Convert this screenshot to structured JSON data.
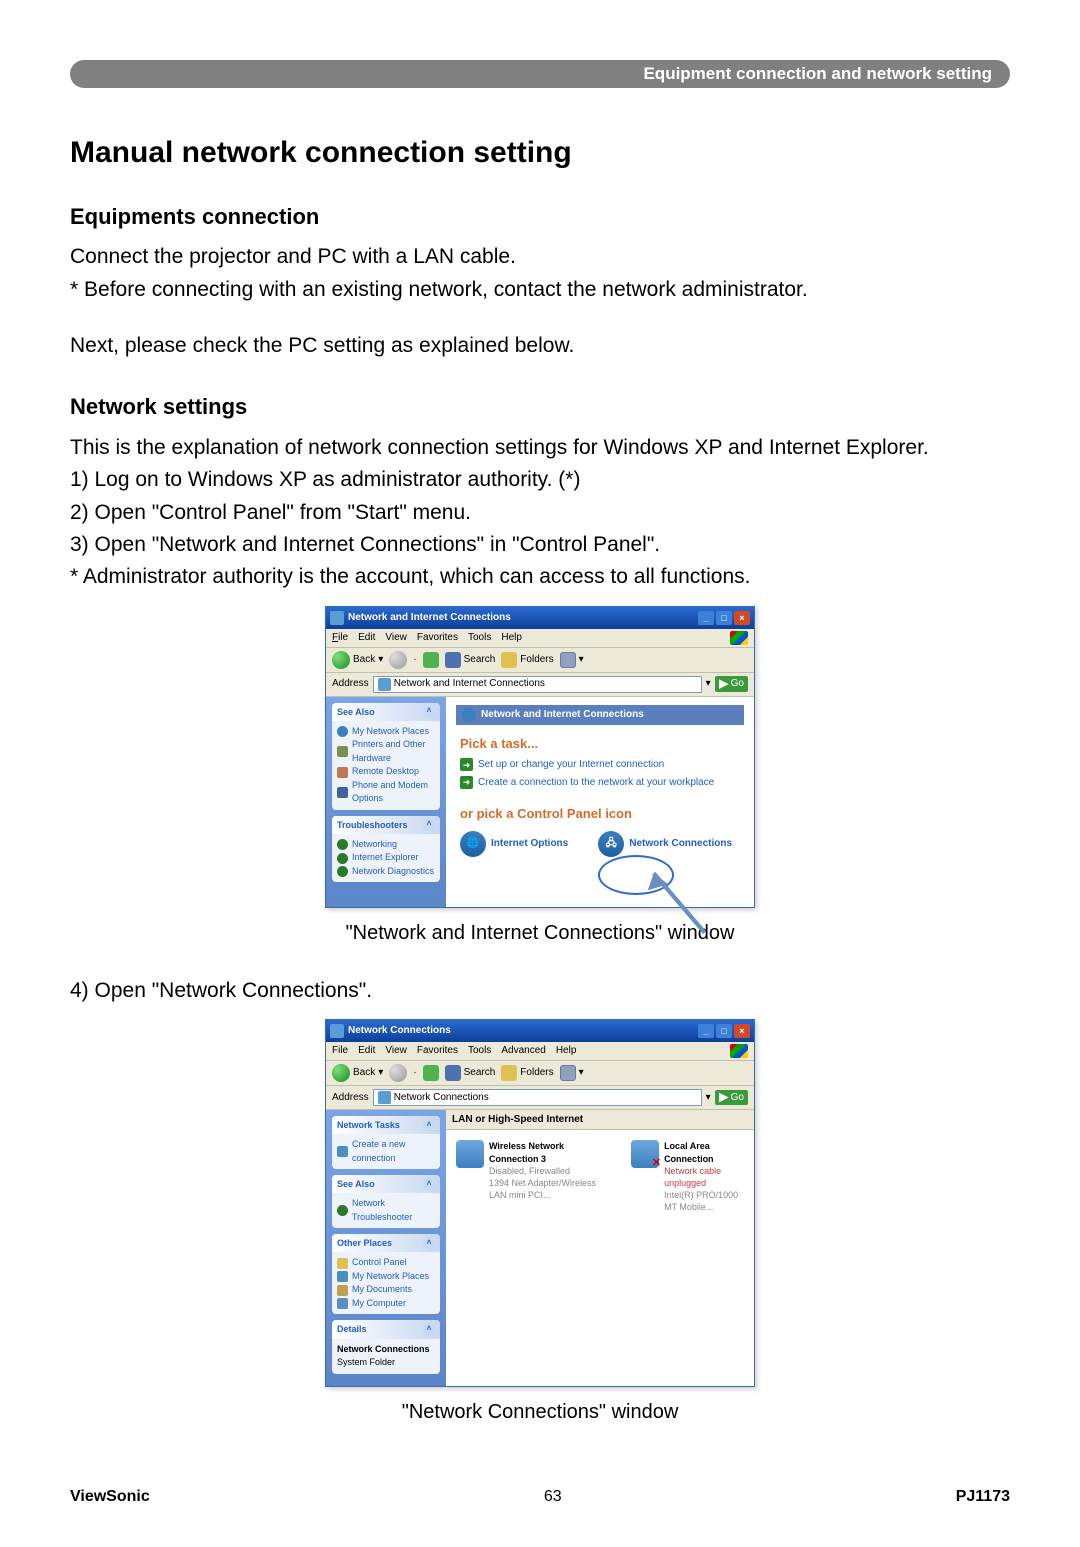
{
  "header": {
    "breadcrumb": "Equipment connection and network setting"
  },
  "title": "Manual network connection setting",
  "sec1": {
    "heading": "Equipments connection",
    "p1": "Connect the projector and PC with a LAN cable.",
    "p2": "* Before connecting with an existing network, contact the network administrator.",
    "p3": "Next, please check the PC setting as explained below."
  },
  "sec2": {
    "heading": "Network settings",
    "p1": "This is the explanation of network connection settings for Windows XP and Internet Explorer.",
    "l1": "1) Log on to Windows XP as administrator authority. (*)",
    "l2": "2) Open \"Control Panel\" from \"Start\" menu.",
    "l3": "3) Open \"Network and Internet Connections\" in \"Control Panel\".",
    "l4": "* Administrator authority is the account, which can access to all functions.",
    "caption1": "\"Network and Internet Connections\" window",
    "step4": "4) Open \"Network Connections\".",
    "caption2": "\"Network Connections\" window"
  },
  "win1": {
    "title": "Network and Internet Connections",
    "menus": {
      "file": "File",
      "edit": "Edit",
      "view": "View",
      "fav": "Favorites",
      "tools": "Tools",
      "help": "Help"
    },
    "toolbar": {
      "back": "Back",
      "search": "Search",
      "folders": "Folders"
    },
    "address_label": "Address",
    "address": "Network and Internet Connections",
    "go": "Go",
    "side": {
      "see_also": "See Also",
      "sa_items": [
        "My Network Places",
        "Printers and Other Hardware",
        "Remote Desktop",
        "Phone and Modem Options"
      ],
      "trouble": "Troubleshooters",
      "tr_items": [
        "Networking",
        "Internet Explorer",
        "Network Diagnostics"
      ]
    },
    "main": {
      "cat": "Network and Internet Connections",
      "pick": "Pick a task...",
      "t1": "Set up or change your Internet connection",
      "t2": "Create a connection to the network at your workplace",
      "or": "or pick a Control Panel icon",
      "io": "Internet Options",
      "nc": "Network Connections"
    }
  },
  "win2": {
    "title": "Network Connections",
    "menus": {
      "file": "File",
      "edit": "Edit",
      "view": "View",
      "fav": "Favorites",
      "tools": "Tools",
      "adv": "Advanced",
      "help": "Help"
    },
    "toolbar": {
      "back": "Back",
      "search": "Search",
      "folders": "Folders"
    },
    "address_label": "Address",
    "address": "Network Connections",
    "go": "Go",
    "side": {
      "ntasks": "Network Tasks",
      "ntask1": "Create a new connection",
      "see_also": "See Also",
      "sa1": "Network Troubleshooter",
      "other": "Other Places",
      "op_items": [
        "Control Panel",
        "My Network Places",
        "My Documents",
        "My Computer"
      ],
      "details": "Details",
      "det1": "Network Connections",
      "det2": "System Folder"
    },
    "main": {
      "group": "LAN or High-Speed Internet",
      "c1_name": "Wireless Network Connection 3",
      "c1_st1": "Disabled, Firewalled",
      "c1_st2": "1394 Net Adapter/Wireless LAN mini PCI...",
      "c2_name": "Local Area Connection",
      "c2_st1": "Network cable unplugged",
      "c2_st2": "Intel(R) PRO/1000 MT Mobile..."
    }
  },
  "footer": {
    "brand": "ViewSonic",
    "page": "63",
    "model": "PJ1173"
  }
}
